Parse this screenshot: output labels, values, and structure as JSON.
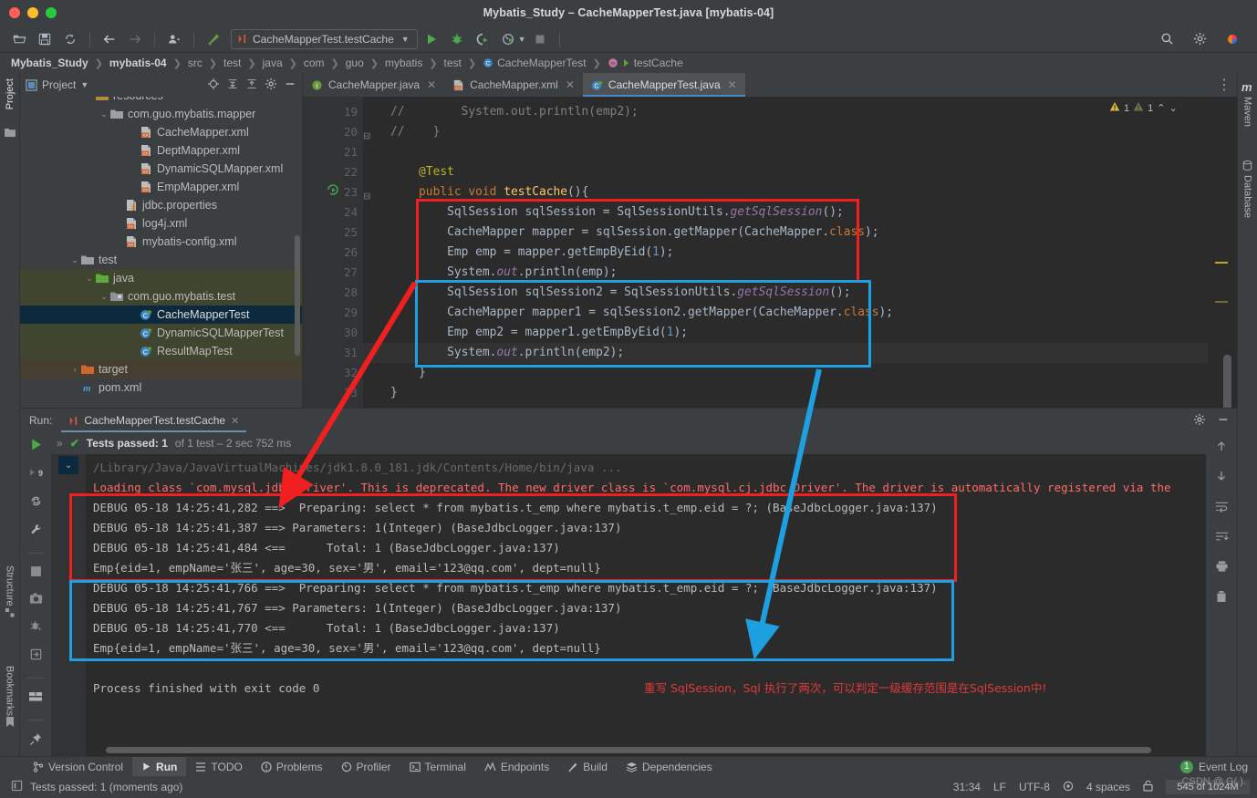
{
  "window": {
    "title": "Mybatis_Study – CacheMapperTest.java [mybatis-04]"
  },
  "toolbar": {
    "icons": [
      "open-folder-icon",
      "save-icon",
      "sync-icon",
      "back-arrow-icon",
      "forward-arrow-icon",
      "user-icon",
      "build-hammer-icon"
    ],
    "run_config": "CacheMapperTest.testCache",
    "right_icons": [
      "search-icon",
      "settings-icon",
      "ide-logo-icon"
    ]
  },
  "breadcrumb": {
    "items": [
      {
        "label": "Mybatis_Study",
        "bold": true
      },
      {
        "label": "mybatis-04",
        "bold": true
      },
      {
        "label": "src",
        "bold": false
      },
      {
        "label": "test",
        "bold": false
      },
      {
        "label": "java",
        "bold": false
      },
      {
        "label": "com",
        "bold": false
      },
      {
        "label": "guo",
        "bold": false
      },
      {
        "label": "mybatis",
        "bold": false
      },
      {
        "label": "test",
        "bold": false
      },
      {
        "label": "CacheMapperTest",
        "bold": false
      },
      {
        "label": "testCache",
        "bold": false
      }
    ]
  },
  "left_strip": {
    "project": "Project",
    "structure": "Structure",
    "bookmarks": "Bookmarks"
  },
  "right_strip": {
    "maven": "Maven",
    "database": "Database"
  },
  "project_panel": {
    "title": "Project",
    "tree": [
      {
        "label": "resources",
        "indent": 4,
        "icon": "resources-folder-icon",
        "arrow": "",
        "state": "clipped"
      },
      {
        "label": "com.guo.mybatis.mapper",
        "indent": 5,
        "icon": "folder-icon",
        "arrow": "v",
        "state": ""
      },
      {
        "label": "CacheMapper.xml",
        "indent": 7,
        "icon": "xml-file-icon",
        "arrow": "",
        "state": ""
      },
      {
        "label": "DeptMapper.xml",
        "indent": 7,
        "icon": "xml-file-icon",
        "arrow": "",
        "state": ""
      },
      {
        "label": "DynamicSQLMapper.xml",
        "indent": 7,
        "icon": "xml-file-icon",
        "arrow": "",
        "state": ""
      },
      {
        "label": "EmpMapper.xml",
        "indent": 7,
        "icon": "xml-file-icon",
        "arrow": "",
        "state": ""
      },
      {
        "label": "jdbc.properties",
        "indent": 6,
        "icon": "properties-file-icon",
        "arrow": "",
        "state": ""
      },
      {
        "label": "log4j.xml",
        "indent": 6,
        "icon": "xml-file-icon",
        "arrow": "",
        "state": ""
      },
      {
        "label": "mybatis-config.xml",
        "indent": 6,
        "icon": "xml-file-icon",
        "arrow": "",
        "state": ""
      },
      {
        "label": "test",
        "indent": 3,
        "icon": "folder-icon",
        "arrow": "v",
        "state": ""
      },
      {
        "label": "java",
        "indent": 4,
        "icon": "source-folder-icon",
        "arrow": "v",
        "state": "greenish"
      },
      {
        "label": "com.guo.mybatis.test",
        "indent": 5,
        "icon": "package-icon",
        "arrow": "v",
        "state": "greenish"
      },
      {
        "label": "CacheMapperTest",
        "indent": 7,
        "icon": "java-test-class-icon",
        "arrow": "",
        "state": "sel"
      },
      {
        "label": "DynamicSQLMapperTest",
        "indent": 7,
        "icon": "java-test-class-icon",
        "arrow": "",
        "state": "greenish"
      },
      {
        "label": "ResultMapTest",
        "indent": 7,
        "icon": "java-test-class-icon",
        "arrow": "",
        "state": "greenish"
      },
      {
        "label": "target",
        "indent": 3,
        "icon": "target-folder-icon",
        "arrow": ">",
        "state": "brown"
      },
      {
        "label": "pom.xml",
        "indent": 3,
        "icon": "maven-icon",
        "arrow": "",
        "state": ""
      }
    ]
  },
  "editor": {
    "tabs": [
      {
        "label": "CacheMapper.java",
        "icon": "java-interface-icon",
        "active": false
      },
      {
        "label": "CacheMapper.xml",
        "icon": "xml-file-icon",
        "active": false
      },
      {
        "label": "CacheMapperTest.java",
        "icon": "java-test-class-icon",
        "active": true
      }
    ],
    "warnings": {
      "warn_count": "1",
      "weak_warn_count": "1"
    },
    "lines": [
      {
        "num": "19",
        "segments": [
          {
            "t": "//        System.out.println(emp2);",
            "c": "cmt"
          }
        ],
        "indent": 0
      },
      {
        "num": "20",
        "segments": [
          {
            "t": "//    }",
            "c": "cmt"
          }
        ],
        "indent": 0,
        "fold": true
      },
      {
        "num": "21",
        "segments": [],
        "indent": 0
      },
      {
        "num": "22",
        "segments": [
          {
            "t": "    ",
            "c": ""
          },
          {
            "t": "@Test",
            "c": "ann"
          }
        ],
        "indent": 0
      },
      {
        "num": "23",
        "segments": [
          {
            "t": "    ",
            "c": ""
          },
          {
            "t": "public void ",
            "c": "kw"
          },
          {
            "t": "testCache",
            "c": "mth"
          },
          {
            "t": "(){",
            "c": ""
          }
        ],
        "indent": 0,
        "gutter_icon": "run-test-icon",
        "fold": true
      },
      {
        "num": "24",
        "segments": [
          {
            "t": "        SqlSession sqlSession = SqlSessionUtils.",
            "c": ""
          },
          {
            "t": "getSqlSession",
            "c": "stat"
          },
          {
            "t": "();",
            "c": ""
          }
        ],
        "indent": 0
      },
      {
        "num": "25",
        "segments": [
          {
            "t": "        CacheMapper mapper = sqlSession.getMapper(CacheMapper.",
            "c": ""
          },
          {
            "t": "class",
            "c": "kw"
          },
          {
            "t": ");",
            "c": ""
          }
        ],
        "indent": 0
      },
      {
        "num": "26",
        "segments": [
          {
            "t": "        Emp emp = mapper.getEmpByEid(",
            "c": ""
          },
          {
            "t": "1",
            "c": "num"
          },
          {
            "t": ");",
            "c": ""
          }
        ],
        "indent": 0
      },
      {
        "num": "27",
        "segments": [
          {
            "t": "        System.",
            "c": ""
          },
          {
            "t": "out",
            "c": "fld"
          },
          {
            "t": ".println(emp);",
            "c": ""
          }
        ],
        "indent": 0
      },
      {
        "num": "28",
        "segments": [
          {
            "t": "        SqlSession sqlSession2 = SqlSessionUtils.",
            "c": ""
          },
          {
            "t": "getSqlSession",
            "c": "stat"
          },
          {
            "t": "();",
            "c": ""
          }
        ],
        "indent": 0
      },
      {
        "num": "29",
        "segments": [
          {
            "t": "        CacheMapper mapper1 = sqlSession2.getMapper(CacheMapper.",
            "c": ""
          },
          {
            "t": "class",
            "c": "kw"
          },
          {
            "t": ");",
            "c": ""
          }
        ],
        "indent": 0
      },
      {
        "num": "30",
        "segments": [
          {
            "t": "        Emp emp2 = mapper1.getEmpByEid(",
            "c": ""
          },
          {
            "t": "1",
            "c": "num"
          },
          {
            "t": ");",
            "c": ""
          }
        ],
        "indent": 0
      },
      {
        "num": "31",
        "segments": [
          {
            "t": "        System.",
            "c": ""
          },
          {
            "t": "out",
            "c": "fld"
          },
          {
            "t": ".println(emp2);",
            "c": ""
          }
        ],
        "indent": 0,
        "current": true
      },
      {
        "num": "32",
        "segments": [
          {
            "t": "    }",
            "c": ""
          }
        ],
        "indent": 0
      },
      {
        "num": "33",
        "segments": [
          {
            "t": "}",
            "c": ""
          }
        ],
        "indent": 0
      }
    ]
  },
  "run_panel": {
    "label": "Run:",
    "tab": "CacheMapperTest.testCache",
    "tests_status_bold": "Tests passed: 1",
    "tests_status_rest": "of 1 test – 2 sec 752 ms",
    "console": [
      {
        "text": "/Library/Java/JavaVirtualMachines/jdk1.8.0_181.jdk/Contents/Home/bin/java ...",
        "type": "path"
      },
      {
        "text": "Loading class `com.mysql.jdbc.Driver'. This is deprecated. The new driver class is `com.mysql.cj.jdbc.Driver'. The driver is automatically registered via the",
        "type": "err"
      },
      {
        "text": "DEBUG 05-18 14:25:41,282 ==>  Preparing: select * from mybatis.t_emp where mybatis.t_emp.eid = ?; (BaseJdbcLogger.java:137)",
        "type": "normal"
      },
      {
        "text": "DEBUG 05-18 14:25:41,387 ==> Parameters: 1(Integer) (BaseJdbcLogger.java:137)",
        "type": "normal"
      },
      {
        "text": "DEBUG 05-18 14:25:41,484 <==      Total: 1 (BaseJdbcLogger.java:137)",
        "type": "normal"
      },
      {
        "text": "Emp{eid=1, empName='张三', age=30, sex='男', email='123@qq.com', dept=null}",
        "type": "normal"
      },
      {
        "text": "DEBUG 05-18 14:25:41,766 ==>  Preparing: select * from mybatis.t_emp where mybatis.t_emp.eid = ?; (BaseJdbcLogger.java:137)",
        "type": "normal"
      },
      {
        "text": "DEBUG 05-18 14:25:41,767 ==> Parameters: 1(Integer) (BaseJdbcLogger.java:137)",
        "type": "normal"
      },
      {
        "text": "DEBUG 05-18 14:25:41,770 <==      Total: 1 (BaseJdbcLogger.java:137)",
        "type": "normal"
      },
      {
        "text": "Emp{eid=1, empName='张三', age=30, sex='男', email='123@qq.com', dept=null}",
        "type": "normal"
      },
      {
        "text": "",
        "type": "normal"
      },
      {
        "text": "Process finished with exit code 0",
        "type": "normal"
      }
    ],
    "annotation_note": "重写 SqlSession，Sql 执行了两次，可以判定一级缓存范围是在SqlSession中!"
  },
  "bottom_bar": {
    "items": [
      {
        "label": "Version Control",
        "icon": "branch-icon",
        "active": false
      },
      {
        "label": "Run",
        "icon": "play-icon",
        "active": true
      },
      {
        "label": "TODO",
        "icon": "list-icon",
        "active": false
      },
      {
        "label": "Problems",
        "icon": "error-icon",
        "active": false
      },
      {
        "label": "Profiler",
        "icon": "profiler-icon",
        "active": false
      },
      {
        "label": "Terminal",
        "icon": "terminal-icon",
        "active": false
      },
      {
        "label": "Endpoints",
        "icon": "endpoints-icon",
        "active": false
      },
      {
        "label": "Build",
        "icon": "build-hammer-icon",
        "active": false
      },
      {
        "label": "Dependencies",
        "icon": "layers-icon",
        "active": false
      }
    ],
    "event_log": "Event Log",
    "event_log_count": "1"
  },
  "status_bar": {
    "left_text": "Tests passed: 1 (moments ago)",
    "caret": "31:34",
    "line_sep": "LF",
    "encoding": "UTF-8",
    "indent": "4 spaces",
    "memory": "545 of 1024M",
    "watermark": "CSDN @ G( )."
  },
  "colors": {
    "accent_blue": "#4a88c7",
    "annotation_red": "#f02020",
    "annotation_blue": "#1e9fe0",
    "console_error": "#ff6b68",
    "selection": "#0d293e"
  }
}
